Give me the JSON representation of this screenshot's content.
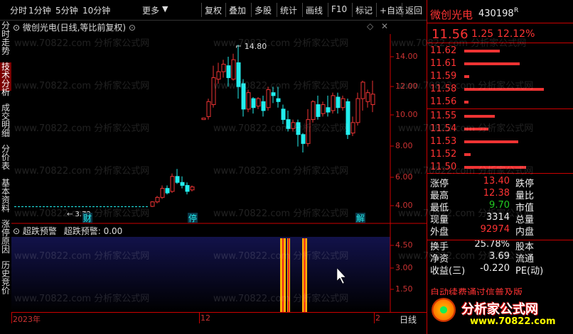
{
  "toolbar": {
    "periods": [
      "分时",
      "1分钟",
      "5分钟",
      "10分钟",
      "更多"
    ],
    "actions": [
      "复权",
      "叠加",
      "多股",
      "统计",
      "画线",
      "F10",
      "标记",
      "+自选",
      "返回"
    ]
  },
  "left_tabs": [
    "分时走势",
    "技术分析",
    "成交明细",
    "分价表",
    "基本资料",
    "涨停原因",
    "历史竞价"
  ],
  "main_chart": {
    "title": "微创光电(日线,等比前复权)",
    "high_label": "14.80",
    "y_ticks": [
      "14.00",
      "12.00",
      "10.00",
      "8.00",
      "6.00",
      "4.00"
    ],
    "markers": [
      "财",
      "停",
      "解"
    ],
    "low_label": "3.72"
  },
  "sub_chart": {
    "title": "超跌预警",
    "value_label": "超跌预警: 0.00",
    "y_ticks": [
      "4.50",
      "3.00",
      "1.50"
    ]
  },
  "time_axis": {
    "labels": [
      "2023年",
      "12",
      "2"
    ],
    "period_tab": "日线"
  },
  "quote": {
    "name": "微创光电",
    "code": "430198",
    "code_suffix": "R",
    "price": "11.56",
    "change": "1.25",
    "change_pct": "12.12%",
    "order_book": [
      {
        "price": "11.62",
        "vol_frac": 0.45
      },
      {
        "price": "11.61",
        "vol_frac": 0.7
      },
      {
        "price": "11.59",
        "vol_frac": 0.06
      },
      {
        "price": "11.58",
        "vol_frac": 1.0
      },
      {
        "price": "11.56",
        "vol_frac": 0.05
      },
      {
        "price": "11.55",
        "vol_frac": 0.38
      },
      {
        "price": "11.54",
        "vol_frac": 0.3
      },
      {
        "price": "11.53",
        "vol_frac": 0.68
      },
      {
        "price": "11.52",
        "vol_frac": 0.08
      },
      {
        "price": "11.50",
        "vol_frac": 0.78
      }
    ],
    "stats": [
      {
        "label": "涨停",
        "value": "13.40",
        "label2": "跌停",
        "vcolor": "red"
      },
      {
        "label": "最高",
        "value": "12.38",
        "label2": "量比",
        "vcolor": "red"
      },
      {
        "label": "最低",
        "value": "9.70",
        "label2": "市值",
        "vcolor": "green"
      },
      {
        "label": "现量",
        "value": "3314",
        "label2": "总量",
        "vcolor": "white"
      },
      {
        "label": "外盘",
        "value": "92974",
        "label2": "内盘",
        "vcolor": "red"
      },
      {
        "label": "换手",
        "value": "25.78%",
        "label2": "股本",
        "vcolor": "white"
      },
      {
        "label": "净资",
        "value": "3.69",
        "label2": "流通",
        "vcolor": "white"
      },
      {
        "label": "收益(三)",
        "value": "-0.220",
        "label2": "PE(动)",
        "vcolor": "white"
      }
    ],
    "ticker_text": "自动续费通过信普及版",
    "logo_text": "分析家公式网",
    "logo_url": "www.70822.com"
  },
  "watermark": "www.70822.com 分析家公式网",
  "colors": {
    "up": "#e33",
    "down": "#2ee",
    "axis": "#c00",
    "sub_bg_top": "#12124a",
    "sub_bg_bottom": "#000"
  }
}
